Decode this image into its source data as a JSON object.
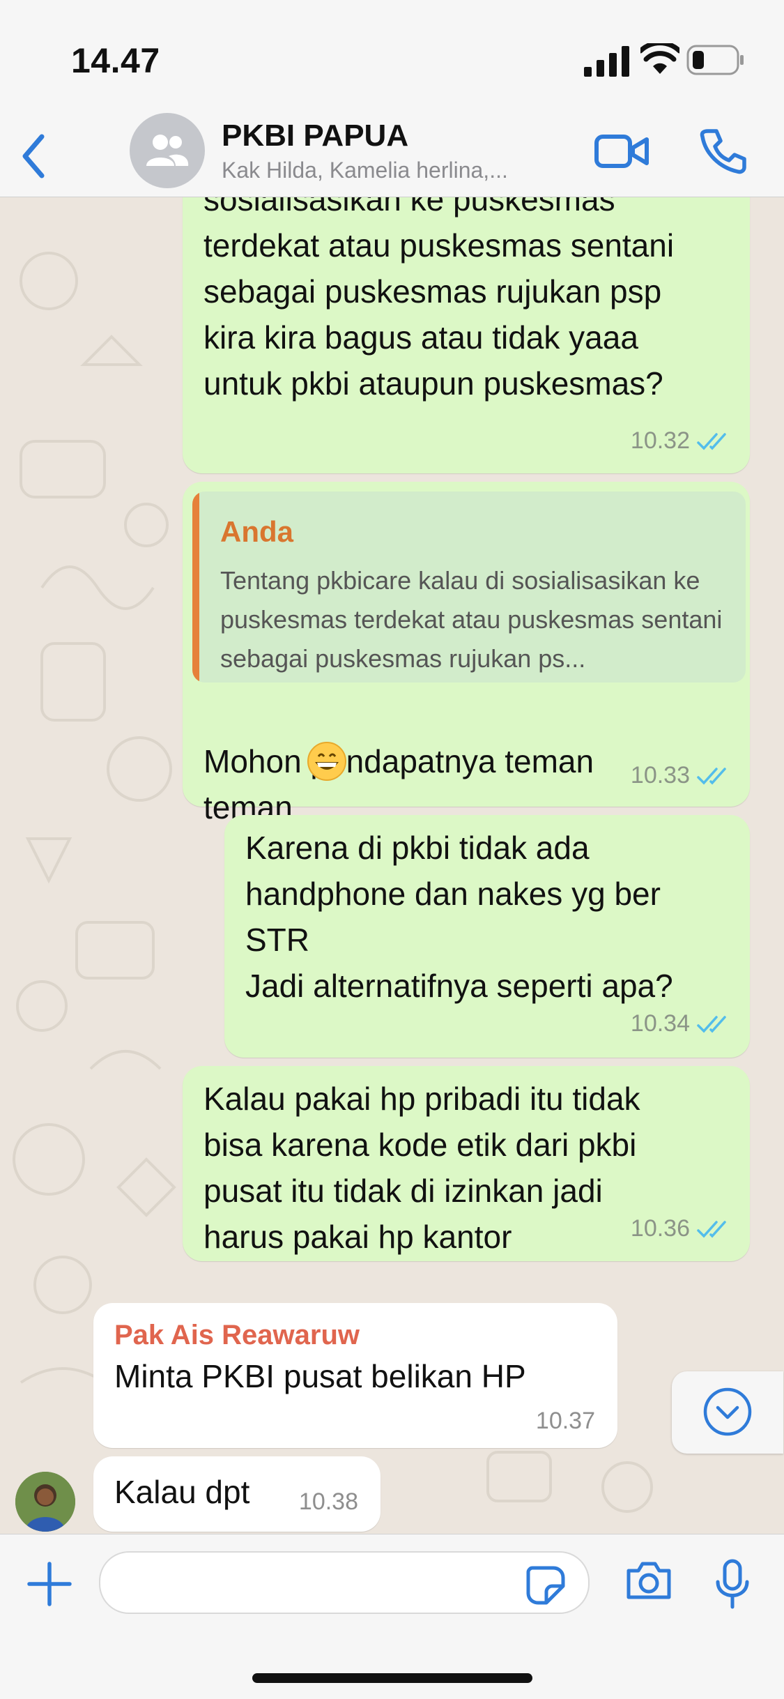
{
  "status_bar": {
    "time": "14.47",
    "icons": [
      "signal-icon",
      "wifi-icon",
      "battery-icon"
    ]
  },
  "header": {
    "back_icon": "chevron-left-icon",
    "group_name": "PKBI PAPUA",
    "members": "Kak Hilda, Kamelia herlina,...",
    "video_icon": "video-camera-icon",
    "call_icon": "phone-icon"
  },
  "colors": {
    "accent": "#2f7bd9",
    "outgoing_bubble": "#dcf8c6",
    "incoming_bubble": "#ffffff",
    "quote_name": "#d9762f",
    "sender_name": "#e0654e",
    "read_ticks": "#53bdeb"
  },
  "messages": [
    {
      "direction": "out",
      "text": "sosialisasikan ke puskesmas\nterdekat atau puskesmas sentani\nsebagai puskesmas rujukan psp\nkira kira bagus atau tidak yaaa\nuntuk pkbi ataupun puskesmas?",
      "time": "10.32",
      "status": "read"
    },
    {
      "direction": "out",
      "quote": {
        "name": "Anda",
        "text": "Tentang pkbicare kalau di sosialisasikan ke puskesmas terdekat atau puskesmas sentani sebagai puskesmas rujukan ps..."
      },
      "text": "Mohon pendapatnya teman\nteman",
      "emoji": "grinning-face-emoji",
      "time": "10.33",
      "status": "read"
    },
    {
      "direction": "out",
      "text": "Karena di pkbi tidak ada\nhandphone dan nakes yg ber\nSTR\nJadi alternatifnya seperti apa?",
      "time": "10.34",
      "status": "read"
    },
    {
      "direction": "out",
      "text": "Kalau pakai hp pribadi itu tidak\nbisa karena kode etik dari pkbi\npusat itu tidak di izinkan jadi\nharus pakai hp kantor",
      "time": "10.36",
      "status": "read"
    },
    {
      "direction": "in",
      "sender": "Pak Ais Reawaruw",
      "text": "Minta PKBI pusat belikan HP",
      "time": "10.37"
    },
    {
      "direction": "in",
      "text": "Kalau dpt",
      "time": "10.38"
    }
  ],
  "scroll_down_icon": "chevron-down-circle-icon",
  "input_bar": {
    "placeholder": "",
    "icons": [
      "plus-icon",
      "sticker-icon",
      "camera-icon",
      "microphone-icon"
    ]
  }
}
